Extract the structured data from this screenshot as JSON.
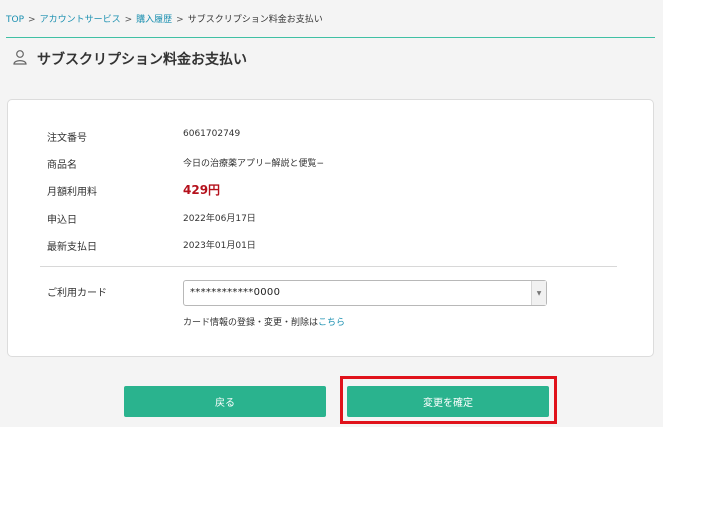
{
  "breadcrumb": {
    "top": "TOP",
    "account": "アカウントサービス",
    "history": "購入履歴",
    "current": "サブスクリプション料金お支払い",
    "separator": ">"
  },
  "page": {
    "title": "サブスクリプション料金お支払い"
  },
  "order": {
    "order_number_label": "注文番号",
    "order_number": "6061702749",
    "product_label": "商品名",
    "product": "今日の治療薬アプリ−解説と便覧−",
    "monthly_fee_label": "月額利用料",
    "monthly_fee": "429円",
    "apply_date_label": "申込日",
    "apply_date": "2022年06月17日",
    "latest_payment_label": "最新支払日",
    "latest_payment": "2023年01月01日"
  },
  "card": {
    "label": "ご利用カード",
    "selected": "************0000",
    "note_prefix": "カード情報の登録・変更・削除は",
    "note_link": "こちら"
  },
  "buttons": {
    "back": "戻る",
    "confirm": "変更を確定"
  },
  "colors": {
    "accent": "#2ab38e",
    "price": "#b5111c",
    "link": "#1a8fb0",
    "highlight": "#e0121b"
  }
}
